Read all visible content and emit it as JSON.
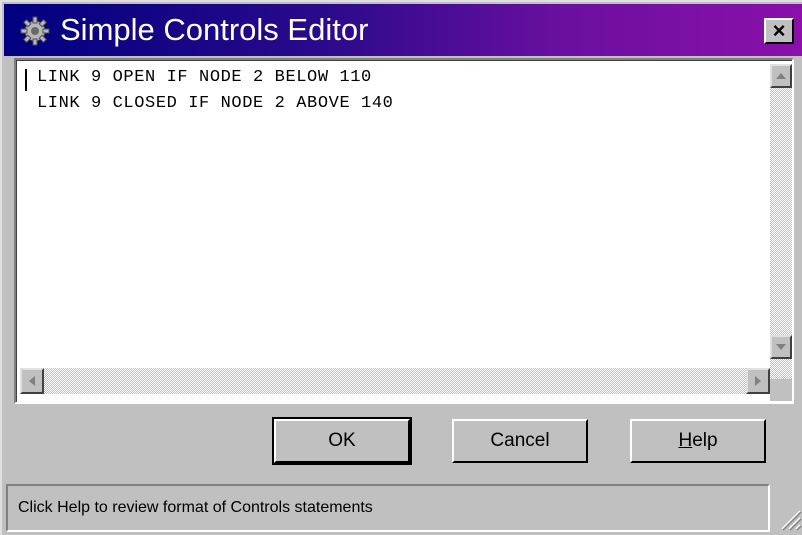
{
  "window": {
    "title": "Simple Controls Editor",
    "app_icon": "gear-icon",
    "close_glyph": "×"
  },
  "editor": {
    "lines": [
      "LINK 9 OPEN IF NODE 2 BELOW 110",
      "LINK 9 CLOSED IF NODE 2 ABOVE 140"
    ]
  },
  "buttons": {
    "ok": "OK",
    "cancel": "Cancel",
    "help_accel": "H",
    "help_rest": "elp"
  },
  "status": {
    "text": "Click Help to review format of Controls statements"
  },
  "colors": {
    "title_gradient_start": "#000080",
    "title_gradient_end": "#8a10a8",
    "face": "#c0c0c0"
  }
}
